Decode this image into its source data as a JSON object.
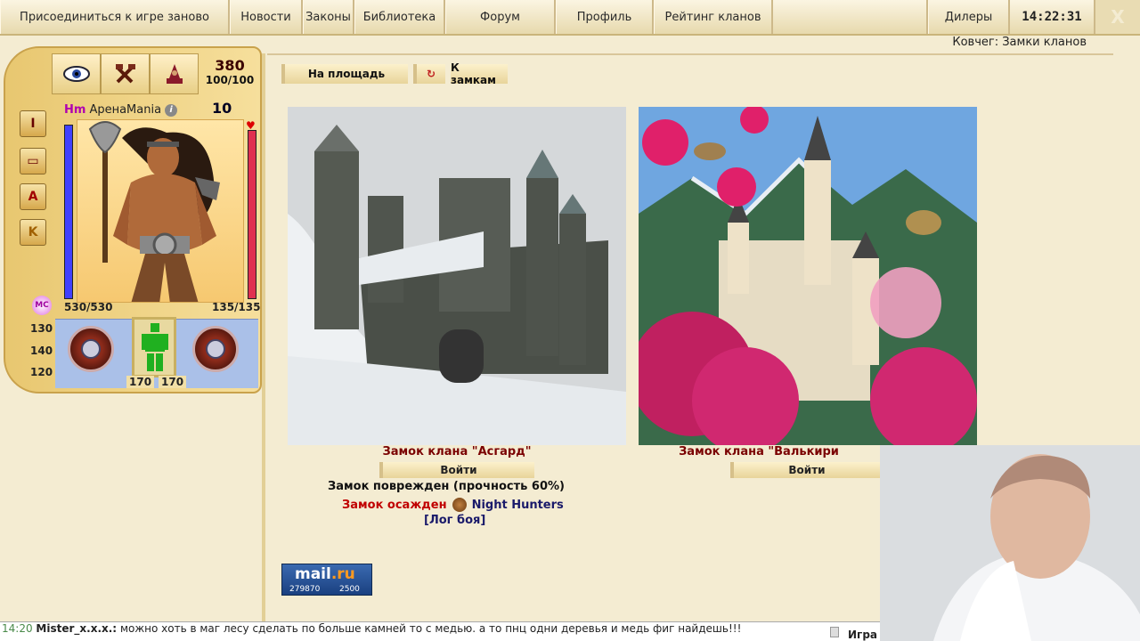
{
  "nav": {
    "join": "Присоединиться к игре заново",
    "news": "Новости",
    "laws": "Законы",
    "library": "Библиотека",
    "forum": "Форум",
    "profile": "Профиль",
    "rating": "Рейтинг кланов",
    "dealers": "Дилеры",
    "clock": "14:22:31",
    "close": "X"
  },
  "location": "Ковчег: Замки кланов",
  "character": {
    "clan_tag": "Hm",
    "name": "ApeнaMania",
    "level": "10",
    "stat_top": "380",
    "stat_ratio": "100/100",
    "hp": "530/530",
    "mana": "135/135",
    "side_buttons": [
      "Ⅰ",
      "▭",
      "A",
      "K"
    ],
    "mc": "MC",
    "side_nums": [
      "130",
      "140",
      "120"
    ],
    "armor_left": "170",
    "armor_right": "170"
  },
  "crumbs": {
    "square": "На площадь",
    "refresh": "↻",
    "castles": "К замкам"
  },
  "castles": [
    {
      "title": "Замок клана \"Асгард\"",
      "enter": "Войти"
    },
    {
      "title": "Замок клана \"Валькири",
      "enter": "Войти"
    }
  ],
  "status": {
    "damaged": "Замок поврежден (прочность 60%)",
    "besieged": "Замок осажден",
    "besieger": "Night Hunters",
    "log": "[Лог боя]"
  },
  "mailru": {
    "logo_a": "mail",
    "logo_b": ".ru",
    "counter1": "279870",
    "counter2": "2500"
  },
  "chat": {
    "time": "14:20",
    "nick": "Mister_x.x.x.:",
    "text": " можно хоть в маг лесу сделать по больше камней то с медью. а то пнц одни деревья и медь фиг найдешь!!!",
    "right_label": "Игра"
  },
  "colors": {
    "bg": "#f4ecd2",
    "castle_title": "#7a0000",
    "besieged": "#c00000",
    "clan_link": "#1a1a6a"
  }
}
